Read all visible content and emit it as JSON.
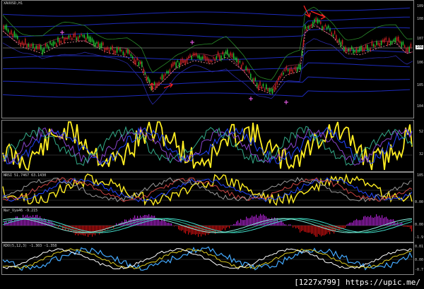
{
  "chart_data": [
    {
      "type": "line",
      "label": "XAUUSD,H1",
      "y_ticks": [
        "109",
        "108",
        "107",
        "106",
        "105",
        "104"
      ],
      "last_price": "108",
      "colors": {
        "price_up": "#22cc33",
        "price_down": "#cc2222",
        "bands": "#2233dd",
        "sma": "#ff99aa"
      }
    },
    {
      "type": "line",
      "label": "",
      "y_ticks": [
        "52",
        "32"
      ],
      "colors": {
        "main": "#ffee22",
        "signal": "#2244ff"
      }
    },
    {
      "type": "line",
      "label": "NRSI 51.7467 63.1430",
      "y_ticks": [
        "105",
        "0.00"
      ],
      "colors": {
        "main": "#ffee22",
        "signal": "#2244ff"
      }
    },
    {
      "type": "bar",
      "label": "Nar_Vya46 -9.215",
      "y_ticks": [
        "0.00",
        "-1.9"
      ],
      "colors": {
        "positive": "#aa22cc",
        "negative": "#cc1111",
        "line": "#44ddcc"
      }
    },
    {
      "type": "line",
      "label": "KDO(5,12,3) -1.303 -1.358",
      "y_ticks": [
        "0.01",
        "0.00",
        "-0.7"
      ],
      "colors": {
        "main": "#44aaff",
        "signal": "#ddcc22"
      }
    }
  ],
  "watermark": "[1227x799] https://upic.me/"
}
